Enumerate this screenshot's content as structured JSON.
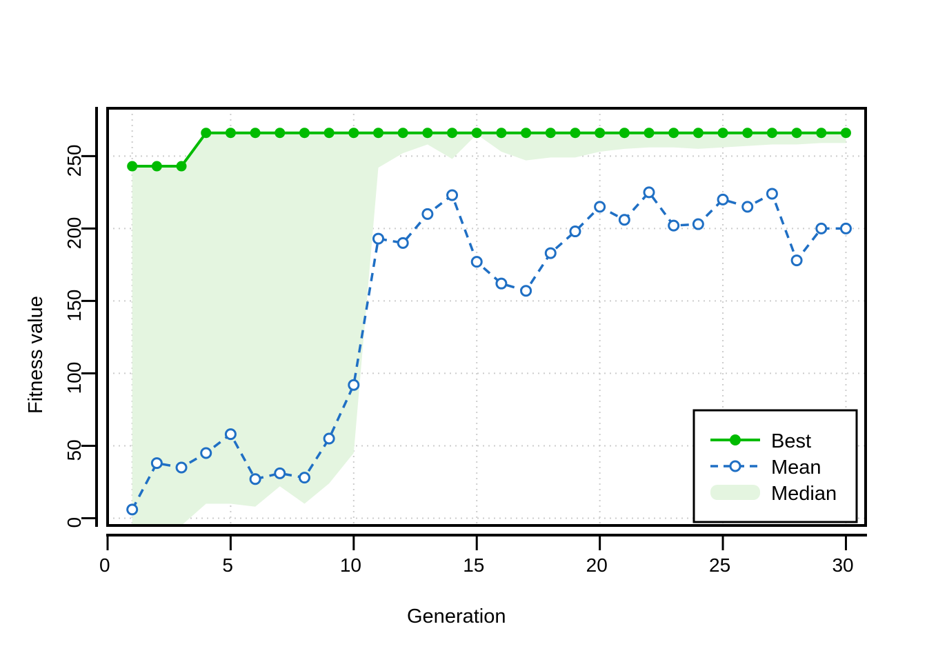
{
  "chart_data": {
    "type": "line",
    "title": "",
    "xlabel": "Generation",
    "ylabel": "Fitness value",
    "xlim": [
      0,
      30.8
    ],
    "ylim": [
      -5,
      283
    ],
    "grid": true,
    "grid_color": "#cccccc",
    "legend_position": "bottom-right",
    "x": [
      1,
      2,
      3,
      4,
      5,
      6,
      7,
      8,
      9,
      10,
      11,
      12,
      13,
      14,
      15,
      16,
      17,
      18,
      19,
      20,
      21,
      22,
      23,
      24,
      25,
      26,
      27,
      28,
      29,
      30
    ],
    "series": [
      {
        "name": "Best",
        "type": "line",
        "color": "#00bb00",
        "style": "solid",
        "marker": "filled-circle",
        "values": [
          243,
          243,
          243,
          266,
          266,
          266,
          266,
          266,
          266,
          266,
          266,
          266,
          266,
          266,
          266,
          266,
          266,
          266,
          266,
          266,
          266,
          266,
          266,
          266,
          266,
          266,
          266,
          266,
          266,
          266
        ]
      },
      {
        "name": "Mean",
        "type": "line",
        "color": "#1f6fc4",
        "style": "dashed",
        "marker": "open-circle",
        "values": [
          6,
          38,
          35,
          45,
          58,
          27,
          31,
          28,
          55,
          92,
          193,
          190,
          210,
          223,
          177,
          162,
          157,
          183,
          198,
          215,
          206,
          225,
          202,
          203,
          220,
          215,
          224,
          178,
          200,
          200
        ]
      },
      {
        "name": "Median",
        "type": "band",
        "color": "#e4f5e0",
        "lower": [
          -5,
          -5,
          -5,
          10,
          10,
          8,
          22,
          10,
          24,
          45,
          242,
          252,
          258,
          248,
          265,
          253,
          247,
          249,
          249,
          253,
          255,
          256,
          256,
          255,
          256,
          257,
          258,
          258,
          259,
          259
        ],
        "upper": [
          243,
          243,
          243,
          266,
          266,
          266,
          266,
          266,
          266,
          266,
          266,
          266,
          266,
          266,
          266,
          266,
          266,
          266,
          266,
          266,
          266,
          266,
          266,
          266,
          266,
          266,
          266,
          266,
          266,
          266
        ]
      }
    ],
    "yticks": [
      0,
      50,
      100,
      150,
      200,
      250
    ],
    "ytick_labels": [
      "0",
      "50",
      "100",
      "150",
      "200",
      "250"
    ],
    "xticks": [
      0,
      5,
      10,
      15,
      20,
      25,
      30
    ],
    "xtick_labels": [
      "0",
      "5",
      "10",
      "15",
      "20",
      "25",
      "30"
    ],
    "legend": [
      {
        "label": "Best",
        "marker": "filled-circle",
        "style": "solid",
        "color": "#00bb00"
      },
      {
        "label": "Mean",
        "marker": "open-circle",
        "style": "dashed",
        "color": "#1f6fc4"
      },
      {
        "label": "Median",
        "marker": "band",
        "style": "fill",
        "color": "#e4f5e0"
      }
    ]
  }
}
